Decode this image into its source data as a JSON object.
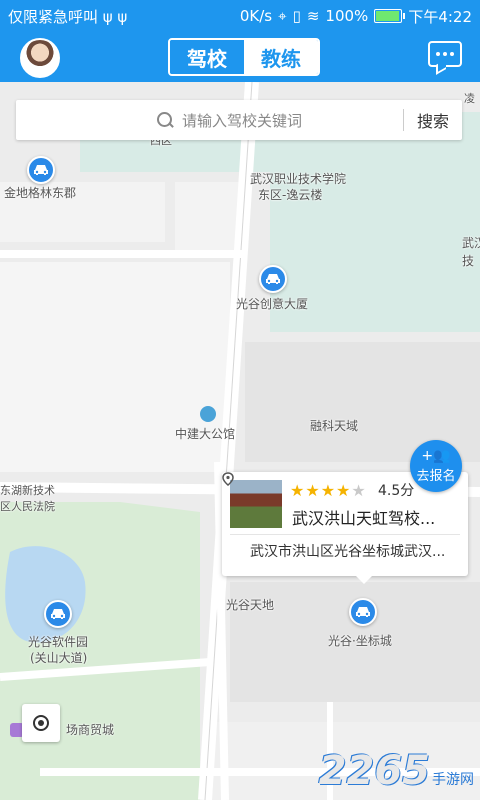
{
  "status_bar": {
    "left_text": "仅限紧急呼叫 ψ ψ",
    "speed": "0K/s",
    "battery_percent": "100%",
    "battery_level": 1.0,
    "time": "下午4:22"
  },
  "nav": {
    "tabs": [
      {
        "label": "驾校",
        "active": true
      },
      {
        "label": "教练",
        "active": false
      }
    ],
    "accent_color": "#1e96ee"
  },
  "search": {
    "placeholder": "请输入驾校关键词",
    "button_label": "搜索"
  },
  "map": {
    "labels": {
      "xiqu": "西区",
      "jindi": "金地格林东郡",
      "wuhan_zhiye": "武汉职业技术学院",
      "dongqu": "东区-逸云楼",
      "wuhan_right": "武汉",
      "ji_right": "技",
      "guanggu_chuangyi": "光谷创意大厦",
      "rongke": "融科天域",
      "zhongjian": "中建大公馆",
      "donghu_xinji": "东湖新技术",
      "renmin_fayuan": "区人民法院",
      "guanggu_tiandi": "光谷天地",
      "guanggu_biaocheng": "光谷·坐标城",
      "guanggu_ruanjian": "光谷软件园",
      "guanshan": "(关山大道)",
      "shangmaocheng": "场商贸城",
      "ling": "凌"
    }
  },
  "card": {
    "stars_filled": 4,
    "stars_total": 5,
    "rating": "4.5分",
    "name": "武汉洪山天虹驾校...",
    "address": "武汉市洪山区光谷坐标城武汉..."
  },
  "signup_button": {
    "label": "去报名",
    "icon": "add-people-icon"
  },
  "watermark": {
    "number": "2265",
    "text": "手游网"
  }
}
